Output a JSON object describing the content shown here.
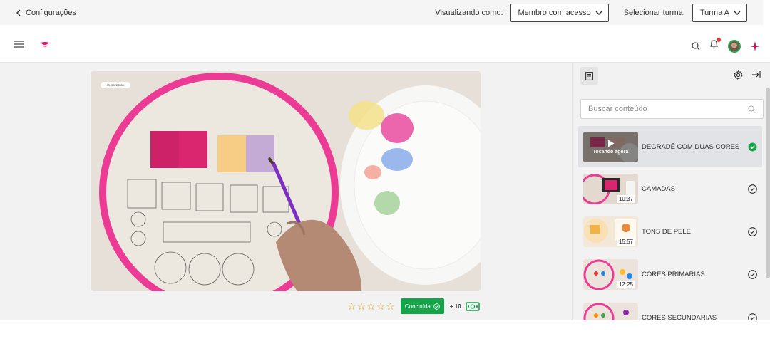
{
  "topbar": {
    "back_label": "Configurações",
    "viewing_as_label": "Visualizando como:",
    "viewing_as_value": "Membro com acesso",
    "class_label": "Selecionar turma:",
    "class_value": "Turma A"
  },
  "header": {
    "icons": [
      "menu-icon",
      "brand-logo",
      "search-icon",
      "bell-icon",
      "avatar",
      "sparkle-icon"
    ],
    "notification_dot_color": "#e53935"
  },
  "player": {
    "video_id": "ID: 53228530",
    "rating_stars": 0,
    "rating_max": 5,
    "complete_label": "Concluída",
    "points": "+ 10",
    "accent_color": "#17a34a"
  },
  "sidebar": {
    "search_placeholder": "Buscar conteúdo",
    "lessons": [
      {
        "title": "DEGRADÊ COM DUAS CORES",
        "duration": "",
        "now_playing": "Tocando agora",
        "completed": true,
        "active": true
      },
      {
        "title": "CAMADAS",
        "duration": "10:37",
        "completed": true,
        "active": false
      },
      {
        "title": "TONS DE PELE",
        "duration": "15:57",
        "completed": true,
        "active": false
      },
      {
        "title": "CORES PRIMARIAS",
        "duration": "12:25",
        "completed": true,
        "active": false
      },
      {
        "title": "CORES SECUNDARIAS",
        "duration": "",
        "completed": true,
        "active": false
      }
    ]
  }
}
